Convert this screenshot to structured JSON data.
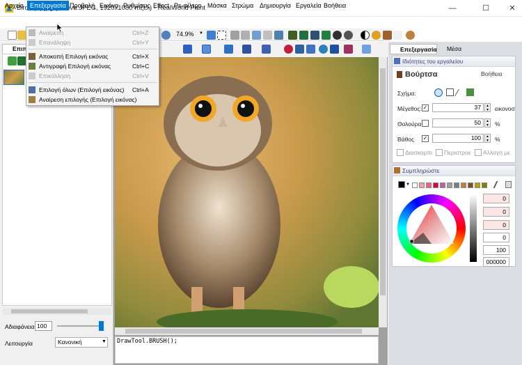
{
  "window": {
    "title": "Birds (B).jpg (Εικόνα.JPEG, 1920x1080 πίξελ) - RealWorld Paint",
    "minimize": "—",
    "maximize": "☐",
    "close": "✕"
  },
  "menubar": {
    "items": [
      "Αρχείο",
      "Επεξεργασία",
      "Προβολή",
      "Εικόνα",
      "Ρυθμίσεις",
      "Effect",
      "Ps-φίλτρο",
      "Μάσκα",
      "Στρώμα",
      "Δημιουργία",
      "Εργαλεία",
      "Βοήθεια"
    ]
  },
  "edit_menu": {
    "items": [
      {
        "label": "Αναίρεση",
        "shortcut": "Ctrl+Z",
        "enabled": false
      },
      {
        "label": "Επανάληψη",
        "shortcut": "Ctrl+Y",
        "enabled": false
      },
      {
        "label": "Αποκοπή Επιλογή εικόνας",
        "shortcut": "Ctrl+X",
        "enabled": true
      },
      {
        "label": "Αντιγραφή Επιλογή εικόνας",
        "shortcut": "Ctrl+C",
        "enabled": true
      },
      {
        "label": "Επικόλληση",
        "shortcut": "Ctrl+V",
        "enabled": false
      },
      {
        "label": "Επιλογή όλων (Επιλογή εικόνας)",
        "shortcut": "Ctrl+A",
        "enabled": true
      },
      {
        "label": "Αναίρεση επιλογής (Επιλογή εικόνας)",
        "shortcut": "",
        "enabled": true
      }
    ]
  },
  "toolbar": {
    "zoom": "74.9%"
  },
  "left_panel": {
    "tab": "Επιπ",
    "opacity_label": "Αδιαφάνεια",
    "opacity_value": "100",
    "opacity_level": 1.0,
    "mode_label": "Λειτουργία",
    "mode_value": "Κανονική"
  },
  "console": {
    "text": "DrawTool.BRUSH();"
  },
  "right_panel": {
    "tabs": [
      "Επεξεργασία",
      "Μέσα"
    ],
    "tool_properties": {
      "header": "Ιδιότητες του εργαλείου",
      "tool_name": "Βούρτσα",
      "help": "Βοήθεια",
      "shape_label": "Σχήμα:",
      "size_label": "Μέγεθος:",
      "size_value": "37",
      "size_unit": "εικονοσ",
      "blur_label": "Θολούρα:",
      "blur_value": "50",
      "blur_unit": "%",
      "depth_label": "Βάθος",
      "depth_value": "100",
      "depth_unit": "%",
      "options": [
        "Διασκορπι",
        "Περιστροε",
        "Αλλαγή με"
      ]
    },
    "complement": {
      "header": "Συμπληρώστε",
      "values": [
        "0",
        "0",
        "0",
        "0",
        "100",
        "000000"
      ]
    }
  },
  "colors": {
    "accent": "#0078d7",
    "swatches": [
      "#000000",
      "#ffffff",
      "#f4a0a0",
      "#f06080",
      "#e00040",
      "#c060a0",
      "#a0a0a0",
      "#708090",
      "#c08040",
      "#805020",
      "#c0a000",
      "#808000"
    ]
  }
}
